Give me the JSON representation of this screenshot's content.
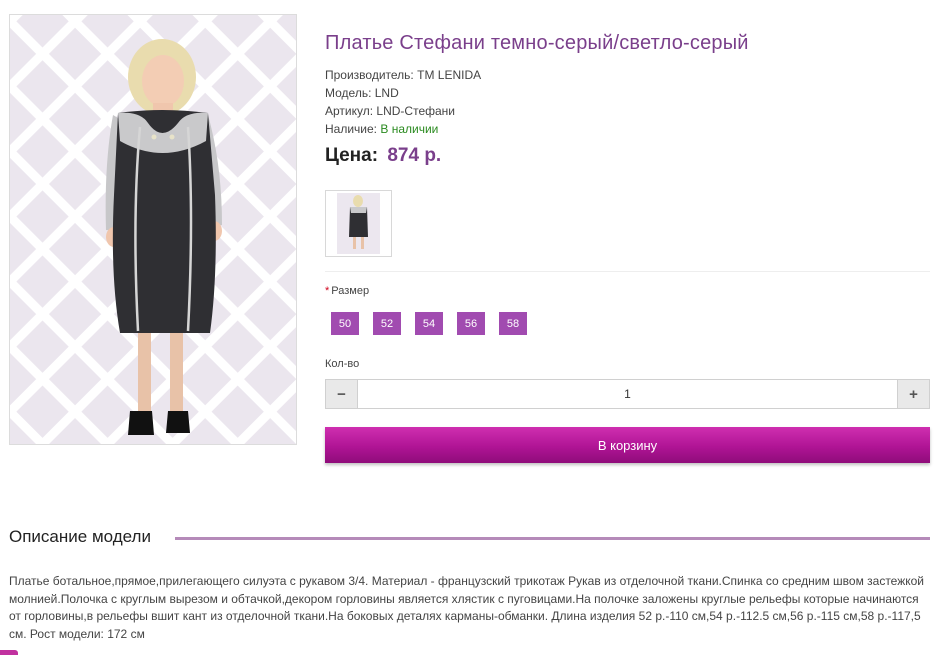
{
  "product": {
    "title": "Платье Стефани темно-серый/светло-серый",
    "manufacturer_label": "Производитель:",
    "manufacturer": "TM LENIDA",
    "model_label": "Модель:",
    "model": "LND",
    "sku_label": "Артикул:",
    "sku": "LND-Стефани",
    "stock_label": "Наличие:",
    "stock": "В наличии",
    "price_label": "Цена:",
    "price": "874 р."
  },
  "options": {
    "size_required": "*",
    "size_label": "Размер",
    "sizes": [
      "50",
      "52",
      "54",
      "56",
      "58"
    ],
    "qty_label": "Кол-во",
    "qty_minus": "−",
    "qty_value": "1",
    "qty_plus": "+",
    "cart_button": "В корзину"
  },
  "description": {
    "heading": "Описание модели",
    "text": "Платье ботальное,прямое,прилегающего силуэта с рукавом 3/4. Материал - французский трикотаж Рукав из отделочной ткани.Спинка со средним швом застежкой молнией.Полочка с круглым вырезом и обтачкой,декором горловины является хлястик с пуговицами.На полочке заложены круглые рельефы которые начинаются от горловины,в рельефы вшит кант из отделочной ткани.На боковых деталях карманы-обманки. Длина изделия 52 р.-110 см,54 р.-112.5 см,56 р.-115 см,58 р.-117,5 см. Рост модели: 172 см"
  },
  "colors": {
    "accent": "#a14bb0",
    "title": "#7a3f8b",
    "cart": "#b01495",
    "in_stock": "#2a8a1f"
  }
}
